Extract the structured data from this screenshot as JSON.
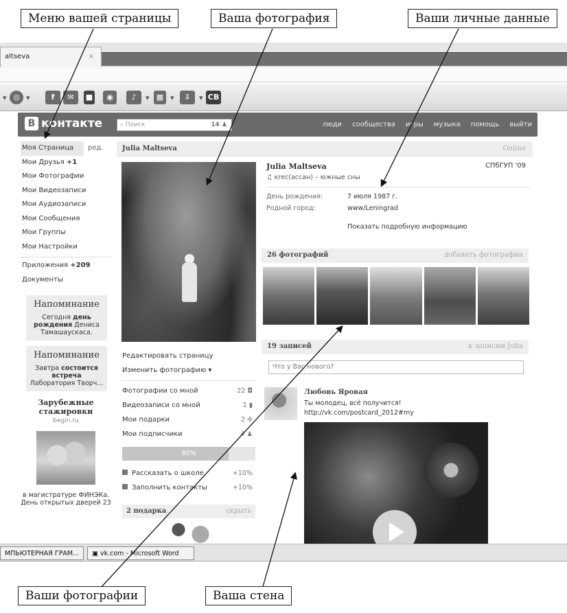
{
  "callouts": {
    "menu": "Меню вашей страницы",
    "photo": "Ваша фотография",
    "personal": "Ваши личные данные",
    "photos": "Ваши фотографии",
    "wall": "Ваша стена"
  },
  "browser": {
    "tab_title": "altseva",
    "toolbar_icons": [
      "compass-icon",
      "facebook-icon",
      "email-icon",
      "camera-icon",
      "record-icon",
      "media-icon",
      "grid-icon",
      "download-icon",
      "cb-icon"
    ],
    "toolbar_cb": "CB"
  },
  "header": {
    "logo": "контакте",
    "logo_letter": "B",
    "search_placeholder": "Поиск",
    "search_count": "14",
    "nav": [
      "люди",
      "сообщества",
      "игры",
      "музыка",
      "помощь",
      "выйти"
    ]
  },
  "menu": {
    "items": [
      {
        "label": "Моя Страница",
        "extra": "ред."
      },
      {
        "label": "Мои Друзья",
        "badge": "+1"
      },
      {
        "label": "Мои Фотографии"
      },
      {
        "label": "Мои Видеозаписи"
      },
      {
        "label": "Мои Аудиозаписи"
      },
      {
        "label": "Мои Сообщения"
      },
      {
        "label": "Мои Группы"
      },
      {
        "label": "Мои Настройки"
      }
    ],
    "apps": {
      "label": "Приложения",
      "badge": "+209"
    },
    "docs": "Документы"
  },
  "reminders": [
    {
      "title": "Напоминание",
      "text_pre": "Сегодня ",
      "text_bold": "день рождения",
      "text_post": " Дениса Тамашаускаса."
    },
    {
      "title": "Напоминание",
      "text_pre": "Завтра ",
      "text_bold": "состоится встреча",
      "text_post": " Лаборатория Творч..."
    }
  ],
  "ad": {
    "title": "Зарубежные стажировки",
    "site": "begin.ru",
    "text": "в магистратуре ФИНЭКа. День открытых дверей 23"
  },
  "profile": {
    "name": "Julia Maltseva",
    "online": "Online",
    "university": "СПбГУП '09",
    "status": "♫ кrес(ассан) – южные сны",
    "birthday_label": "День рождения:",
    "birthday": "7 июля 1987 г.",
    "city_label": "Родной город:",
    "city": "www/Leningrad",
    "more": "Показать подробную информацию"
  },
  "profile_links": {
    "edit": "Редактировать страницу",
    "change_photo": "Изменить фотографию ▾",
    "counts": [
      {
        "label": "Фотографии со мной",
        "count": "22"
      },
      {
        "label": "Видеозаписи со мной",
        "count": "1"
      },
      {
        "label": "Мои подарки",
        "count": "2"
      },
      {
        "label": "Мои подписчики",
        "count": "4"
      }
    ],
    "progress": "80%",
    "progress_value": 0.8,
    "tasks": [
      {
        "label": "Рассказать о школе",
        "value": "+10%"
      },
      {
        "label": "Заполнить контакты",
        "value": "+10%"
      }
    ]
  },
  "gifts": {
    "title": "2 подарка",
    "hide": "скрыть"
  },
  "photos": {
    "title": "26 фотографий",
    "add": "добавить фотографии"
  },
  "wall": {
    "count": "19 записей",
    "link": "к записям Julia",
    "placeholder": "Что у Вас нового?",
    "post": {
      "author": "Любовь Яровая",
      "text": "Ты молодец, всё получится!",
      "link": "http://vk.com/postcard_2012#my"
    }
  },
  "taskbar": {
    "btn1": "МПЬЮТЕРНАЯ ГРАМ...",
    "btn2": "vk.com - Microsoft Word"
  }
}
